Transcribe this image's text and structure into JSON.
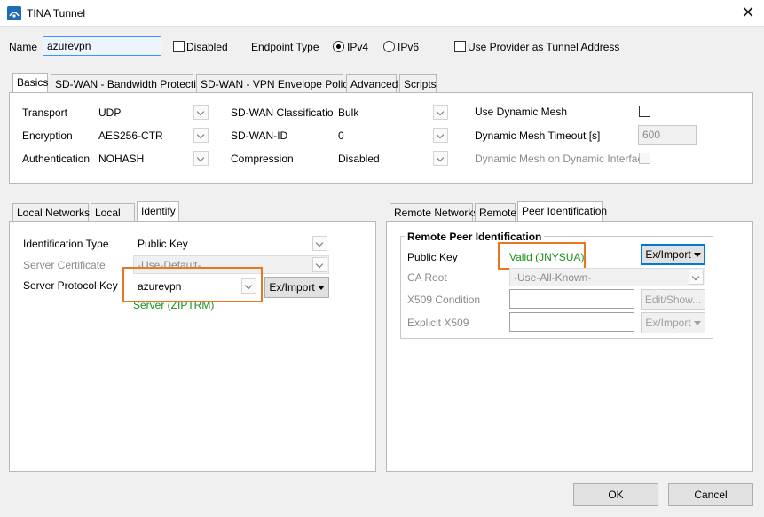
{
  "window": {
    "title": "TINA Tunnel"
  },
  "top": {
    "name_label": "Name",
    "name_value": "azurevpn",
    "disabled_label": "Disabled",
    "endpoint_type_label": "Endpoint Type",
    "ipv4_label": "IPv4",
    "ipv6_label": "IPv6",
    "endpoint_type_selected": "IPv4",
    "use_provider_label": "Use Provider as Tunnel Address"
  },
  "main_tabs": [
    "Basics",
    "SD-WAN - Bandwidth Protection",
    "SD-WAN - VPN Envelope Policy",
    "Advanced",
    "Scripts"
  ],
  "basics": {
    "transport_label": "Transport",
    "transport_value": "UDP",
    "encryption_label": "Encryption",
    "encryption_value": "AES256-CTR",
    "authentication_label": "Authentication",
    "authentication_value": "NOHASH",
    "sdwan_class_label": "SD-WAN Classification",
    "sdwan_class_value": "Bulk",
    "sdwan_id_label": "SD-WAN-ID",
    "sdwan_id_value": "0",
    "compression_label": "Compression",
    "compression_value": "Disabled",
    "dynamic_mesh_label": "Use Dynamic Mesh",
    "dynamic_mesh_timeout_label": "Dynamic Mesh Timeout [s]",
    "dynamic_mesh_timeout_value": "600",
    "dynamic_mesh_iface_label": "Dynamic Mesh on Dynamic Interface"
  },
  "left_tabs": [
    "Local Networks",
    "Local",
    "Identify"
  ],
  "identify": {
    "id_type_label": "Identification Type",
    "id_type_value": "Public Key",
    "server_cert_label": "Server Certificate",
    "server_cert_value": "-Use-Default-",
    "server_protocol_key_label": "Server Protocol Key",
    "server_protocol_key_value": "azurevpn",
    "ex_import_label": "Ex/Import",
    "key_status": "Server (ZIPTRM)"
  },
  "right_tabs": [
    "Remote Networks",
    "Remote",
    "Peer Identification"
  ],
  "peer": {
    "group_title": "Remote Peer Identification",
    "public_key_label": "Public Key",
    "public_key_value": "Valid (JNYSUA)",
    "ex_import_label": "Ex/Import",
    "ca_root_label": "CA Root",
    "ca_root_value": "-Use-All-Known-",
    "x509_condition_label": "X509 Condition",
    "edit_show_label": "Edit/Show...",
    "explicit_x509_label": "Explicit X509",
    "ex_import2_label": "Ex/Import"
  },
  "footer": {
    "ok_label": "OK",
    "cancel_label": "Cancel"
  },
  "colors": {
    "highlight": "#e87722",
    "valid_green": "#1a8f1a",
    "focus_blue": "#0078d7"
  },
  "icons": {
    "app": "tina-app-icon",
    "close": "close-icon"
  }
}
